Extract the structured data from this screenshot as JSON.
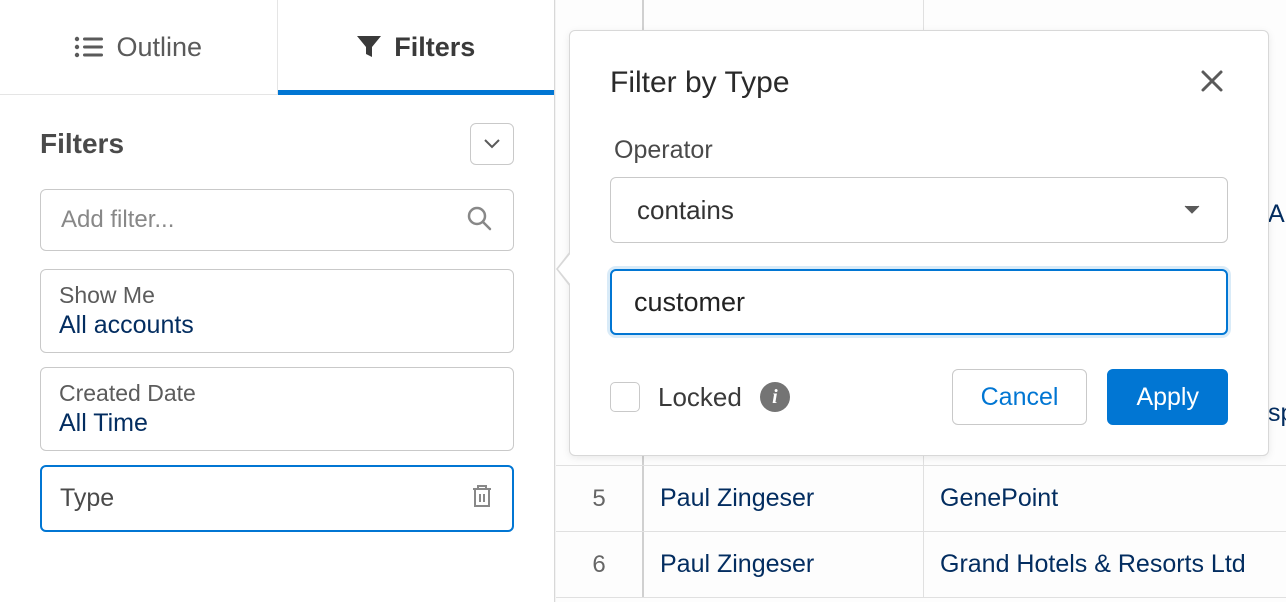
{
  "tabs": {
    "outline": "Outline",
    "filters": "Filters"
  },
  "sidebar": {
    "title": "Filters",
    "addFilterPlaceholder": "Add filter...",
    "cards": [
      {
        "label": "Show Me",
        "value": "All accounts"
      },
      {
        "label": "Created Date",
        "value": "All Time"
      }
    ],
    "selectedCard": {
      "label": "Type"
    }
  },
  "popover": {
    "title": "Filter by Type",
    "operatorLabel": "Operator",
    "operatorValue": "contains",
    "inputValue": "customer",
    "lockedLabel": "Locked",
    "cancel": "Cancel",
    "apply": "Apply"
  },
  "table": {
    "rows": [
      {
        "num": "5",
        "owner": "Paul Zingeser",
        "account": "GenePoint"
      },
      {
        "num": "6",
        "owner": "Paul Zingeser",
        "account": "Grand Hotels & Resorts Ltd"
      }
    ],
    "edgeA": "A",
    "edgeSp": "sp"
  }
}
